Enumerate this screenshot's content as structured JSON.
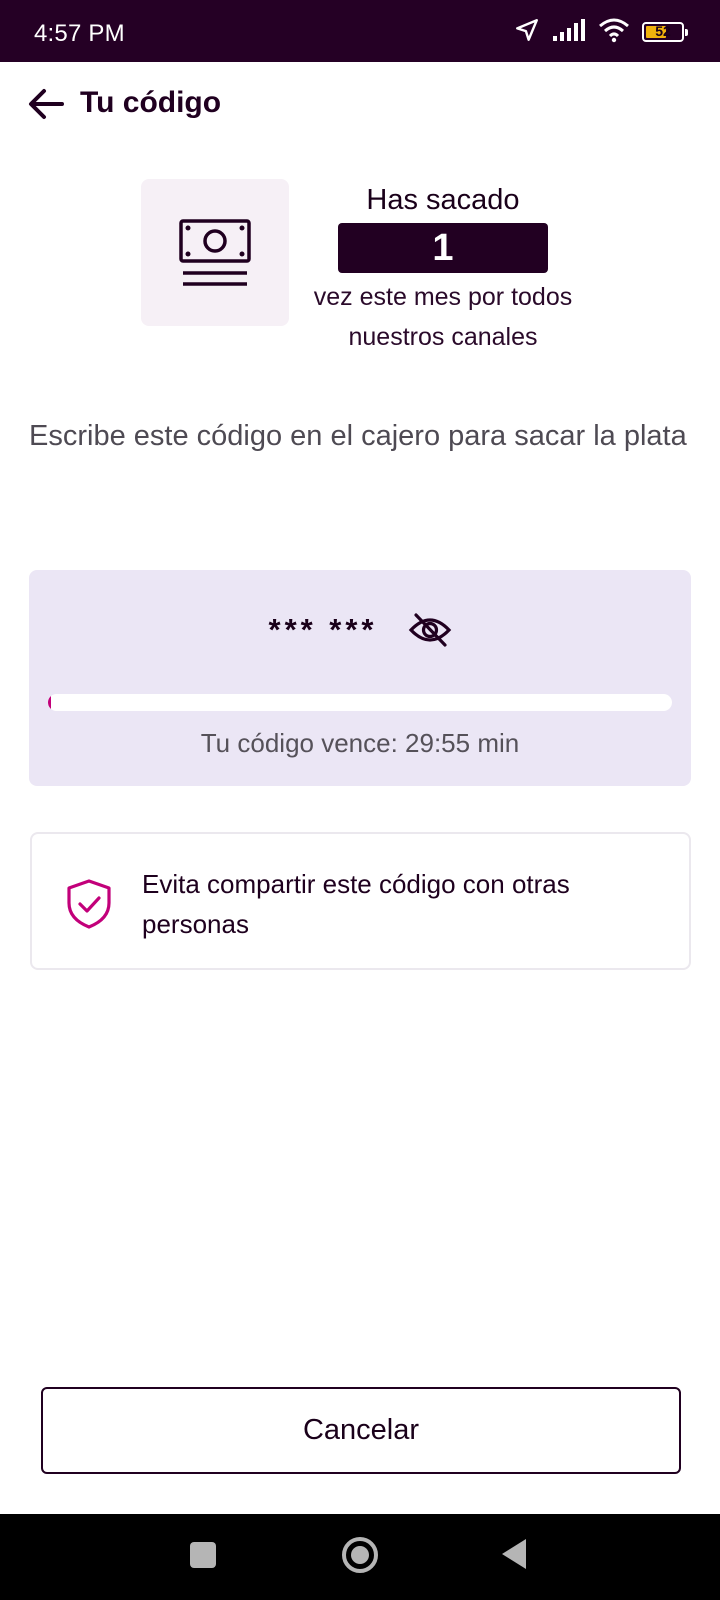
{
  "status_bar": {
    "time": "4:57 PM",
    "battery_level": "52",
    "icons": [
      "navigation-icon",
      "signal-icon",
      "wifi-icon",
      "battery-icon"
    ]
  },
  "header": {
    "title": "Tu código",
    "back_icon": "arrow-left-icon"
  },
  "withdrawal_summary": {
    "icon": "cash-icon",
    "line_top": "Has sacado",
    "count": "1",
    "line_bottom": "vez este mes por todos nuestros canales"
  },
  "instructions": "Escribe este código en el cajero para sacar la plata",
  "code_card": {
    "masked_code": "*** ***",
    "toggle_icon": "eye-off-icon",
    "expiry_text": "Tu código vence: 29:55 min",
    "remaining_fraction": 0.003,
    "progress_color": "#c2007a"
  },
  "warning": {
    "icon": "shield-check-icon",
    "text": "Evita compartir este código con otras personas",
    "icon_color": "#c2007a"
  },
  "actions": {
    "cancel_label": "Cancelar"
  },
  "nav_bar": {
    "icons": [
      "recents-icon",
      "home-icon",
      "back-icon"
    ]
  },
  "colors": {
    "brand_dark": "#220022",
    "card_bg": "#ebe6f5",
    "accent": "#c2007a"
  }
}
